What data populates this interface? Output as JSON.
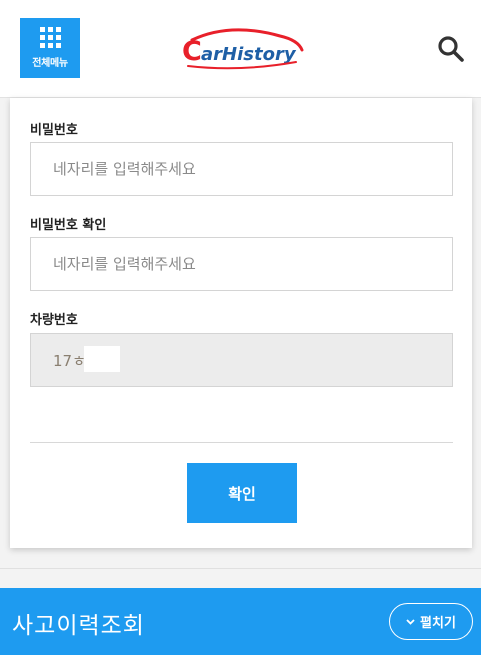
{
  "header": {
    "menu_label": "전체메뉴",
    "logo_text": "CarHistory",
    "brand_color": "#1e9bf0",
    "logo_red": "#e8202a",
    "logo_blue": "#1e5fa6",
    "search_icon": "search-icon"
  },
  "form": {
    "password_label": "비밀번호",
    "password_placeholder": "네자리를 입력해주세요",
    "password_confirm_label": "비밀번호 확인",
    "password_confirm_placeholder": "네자리를 입력해주세요",
    "car_number_label": "차량번호",
    "car_number_value": "17ㅎ",
    "confirm_label": "확인"
  },
  "accident": {
    "title": "사고이력조회",
    "expand_label": "펼치기",
    "expand_icon": "chevron-down-icon"
  }
}
